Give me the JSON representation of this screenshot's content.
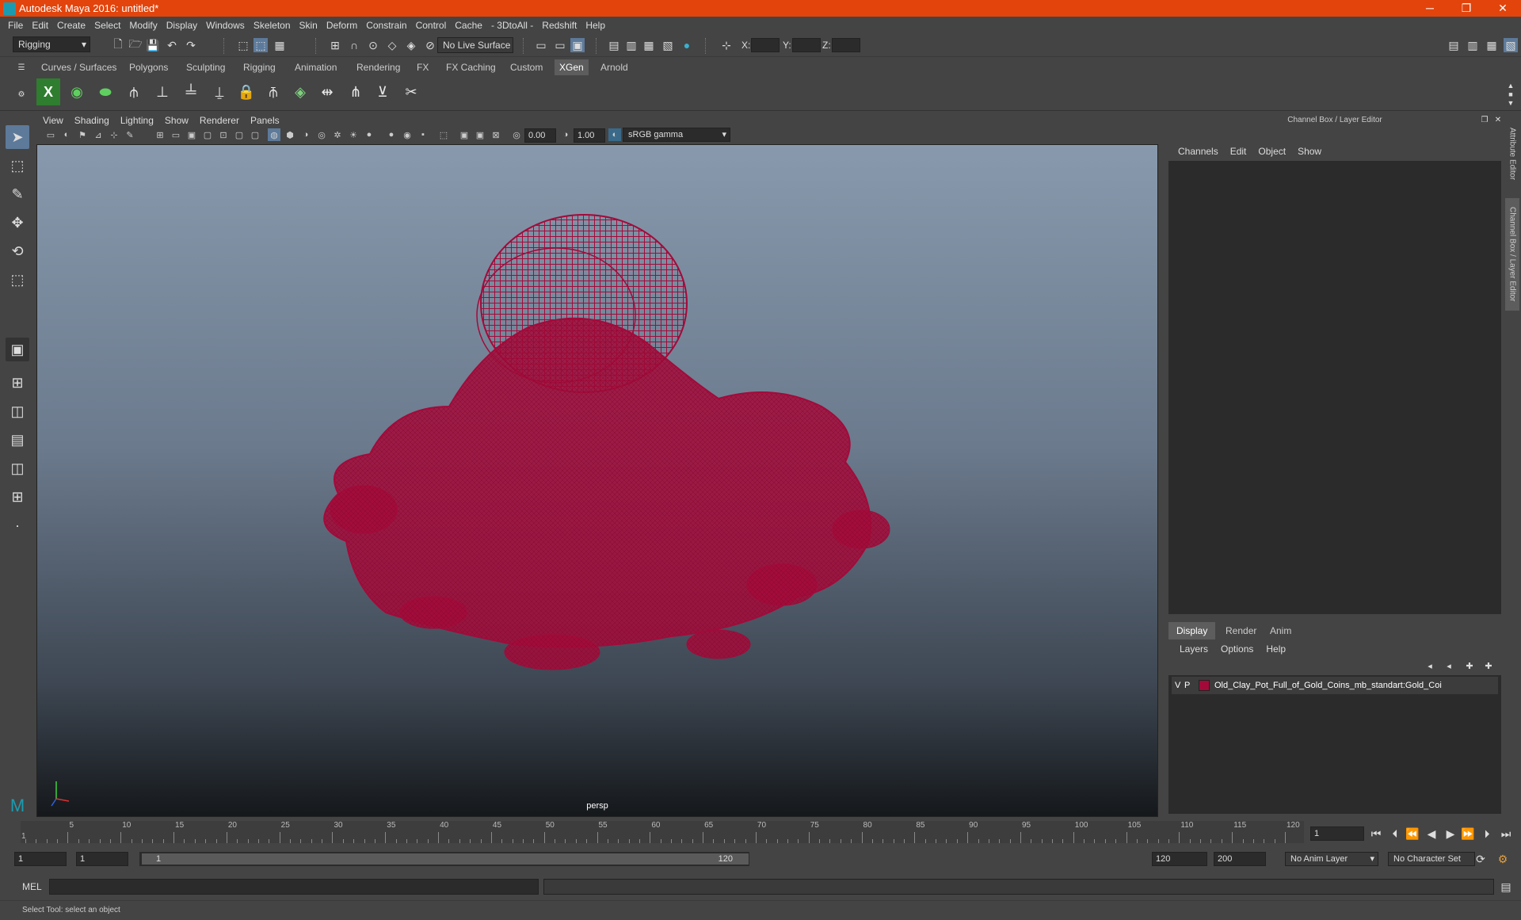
{
  "window": {
    "title": "Autodesk Maya 2016: untitled*",
    "minimize": "─",
    "restore": "❐",
    "close": "✕"
  },
  "menu": [
    "File",
    "Edit",
    "Create",
    "Select",
    "Modify",
    "Display",
    "Windows",
    "Skeleton",
    "Skin",
    "Deform",
    "Constrain",
    "Control",
    "Cache",
    "- 3DtoAll -",
    "Redshift",
    "Help"
  ],
  "status": {
    "mode": "Rigging",
    "live_surface": "No Live Surface",
    "x_label": "X:",
    "y_label": "Y:",
    "z_label": "Z:"
  },
  "shelf_tabs": [
    "Curves / Surfaces",
    "Polygons",
    "Sculpting",
    "Rigging",
    "Animation",
    "Rendering",
    "FX",
    "FX Caching",
    "Custom",
    "XGen",
    "Arnold"
  ],
  "shelf_active": "XGen",
  "viewport": {
    "menu": [
      "View",
      "Shading",
      "Lighting",
      "Show",
      "Renderer",
      "Panels"
    ],
    "exposure": "0.00",
    "gamma": "1.00",
    "color_space": "sRGB gamma",
    "camera_label": "persp",
    "wire_color": "#a30a3a"
  },
  "channel_box": {
    "title": "Channel Box / Layer Editor",
    "menu": [
      "Channels",
      "Edit",
      "Object",
      "Show"
    ]
  },
  "layer_editor": {
    "tabs": [
      "Display",
      "Render",
      "Anim"
    ],
    "menu": [
      "Layers",
      "Options",
      "Help"
    ],
    "layer": {
      "v": "V",
      "p": "P",
      "color": "#a30a3a",
      "name": "Old_Clay_Pot_Full_of_Gold_Coins_mb_standart:Gold_Coi"
    }
  },
  "side_tabs": [
    "Attribute Editor",
    "Channel Box / Layer Editor"
  ],
  "timeline": {
    "ticks": [
      "5",
      "10",
      "15",
      "20",
      "25",
      "30",
      "35",
      "40",
      "45",
      "50",
      "55",
      "60",
      "65",
      "70",
      "75",
      "80",
      "85",
      "90",
      "95",
      "100",
      "105",
      "110",
      "115",
      "120"
    ],
    "start_label": "1",
    "current_frame": "1"
  },
  "range": {
    "start": "1",
    "start2": "1",
    "slider_start": "1",
    "slider_end": "120",
    "end": "120",
    "end2": "200",
    "anim_layer": "No Anim Layer",
    "char_set": "No Character Set"
  },
  "mel": {
    "label": "MEL"
  },
  "help_line": "Select Tool: select an object"
}
